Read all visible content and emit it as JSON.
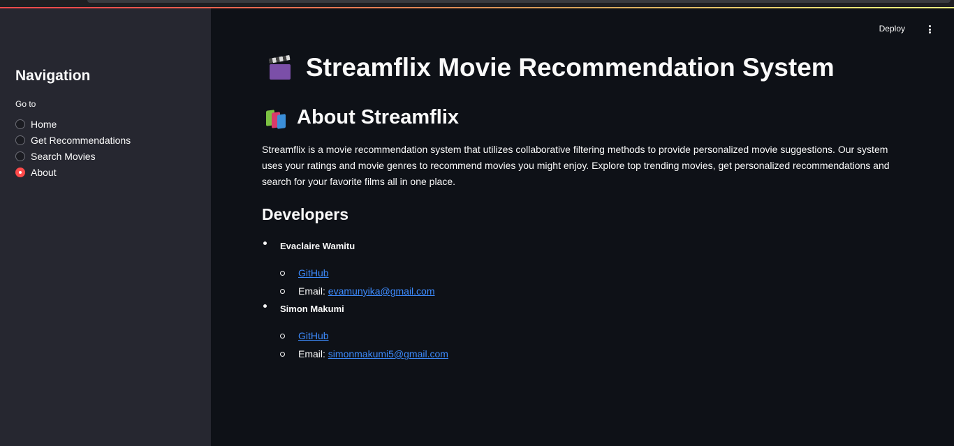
{
  "sidebar": {
    "title": "Navigation",
    "radio_label": "Go to",
    "items": [
      {
        "label": "Home",
        "checked": false
      },
      {
        "label": "Get Recommendations",
        "checked": false
      },
      {
        "label": "Search Movies",
        "checked": false
      },
      {
        "label": "About",
        "checked": true
      }
    ]
  },
  "header": {
    "deploy_label": "Deploy",
    "menu_icon": "kebab-menu-icon"
  },
  "main": {
    "title": "Streamflix Movie Recommendation System",
    "title_icon": "clapper-board-icon",
    "about_heading": "About Streamflix",
    "about_icon": "books-icon",
    "about_text": "Streamflix is a movie recommendation system that utilizes collaborative filtering methods to provide personalized movie suggestions. Our system uses your ratings and movie genres to recommend movies you might enjoy. Explore top trending movies, get personalized recommendations and search for your favorite films all in one place.",
    "developers_heading": "Developers",
    "developers": [
      {
        "name": "Evaclaire Wamitu",
        "github_label": "GitHub",
        "email_prefix": "Email: ",
        "email": "evamunyika@gmail.com"
      },
      {
        "name": "Simon Makumi",
        "github_label": "GitHub",
        "email_prefix": "Email: ",
        "email": "simonmakumi5@gmail.com"
      }
    ]
  },
  "colors": {
    "background": "#0e1117",
    "sidebar": "#262730",
    "accent": "#ff4b4b",
    "link": "#3d8bfd",
    "text": "#fafafa"
  }
}
